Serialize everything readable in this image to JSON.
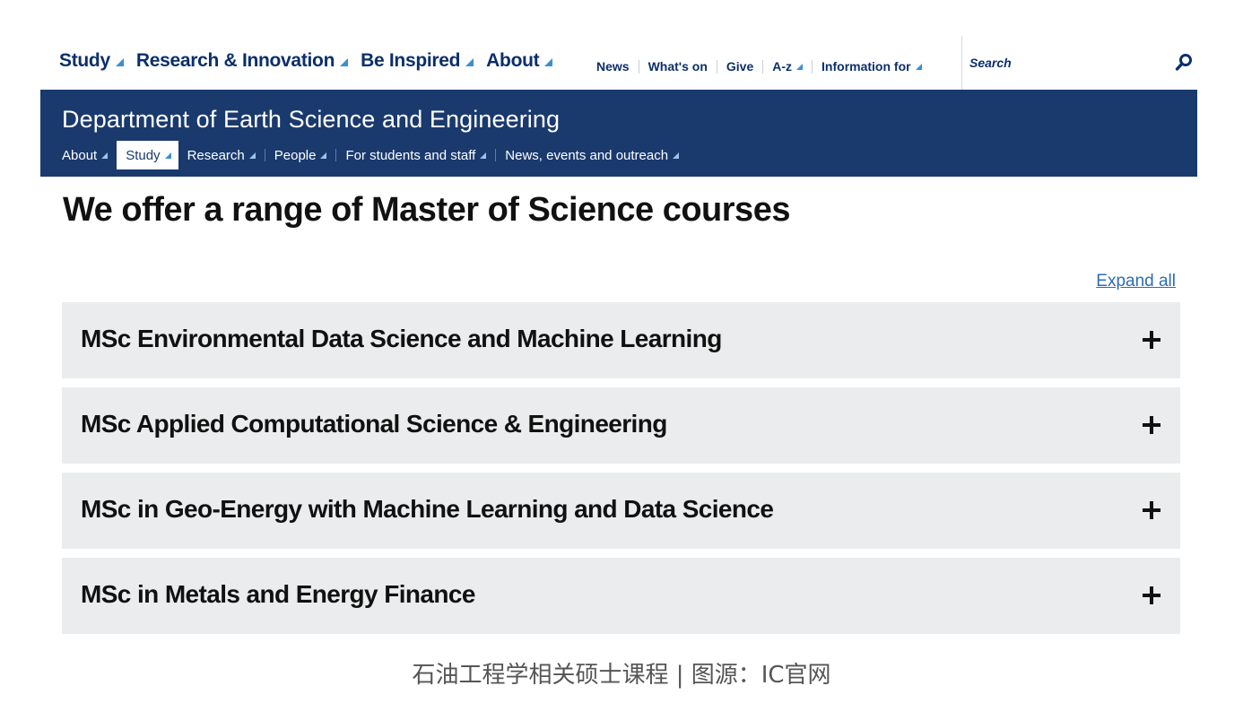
{
  "top_nav": {
    "main_links": [
      {
        "label": "Study"
      },
      {
        "label": "Research & Innovation"
      },
      {
        "label": "Be Inspired"
      },
      {
        "label": "About"
      }
    ],
    "utility_links": [
      {
        "label": "News",
        "has_dropdown": false
      },
      {
        "label": "What's on",
        "has_dropdown": false
      },
      {
        "label": "Give",
        "has_dropdown": false
      },
      {
        "label": "A-z",
        "has_dropdown": true
      },
      {
        "label": "Information for",
        "has_dropdown": true
      }
    ],
    "search": {
      "placeholder": "Search",
      "icon": "search-icon"
    },
    "dropdown_icon": "triangle-icon",
    "link_color": "#0b2f6b",
    "accent_color": "#3a8fd1"
  },
  "department": {
    "title": "Department of Earth Science and Engineering",
    "background_color": "#1a3a6e",
    "nav": [
      {
        "label": "About",
        "active": false
      },
      {
        "label": "Study",
        "active": true
      },
      {
        "label": "Research",
        "active": false
      },
      {
        "label": "People",
        "active": false
      },
      {
        "label": "For students and staff",
        "active": false
      },
      {
        "label": "News, events and outreach",
        "active": false
      }
    ]
  },
  "content": {
    "heading": "We offer a range of Master of Science courses",
    "expand_all": "Expand all",
    "courses": [
      {
        "title": "MSc Environmental Data Science and Machine Learning",
        "icon": "plus-icon"
      },
      {
        "title": "MSc Applied Computational Science & Engineering",
        "icon": "plus-icon"
      },
      {
        "title": "MSc in Geo-Energy with Machine Learning and Data Science",
        "icon": "plus-icon"
      },
      {
        "title": "MSc in Metals and Energy Finance",
        "icon": "plus-icon"
      }
    ]
  },
  "caption": "石油工程学相关硕士课程 | 图源：IC官网"
}
